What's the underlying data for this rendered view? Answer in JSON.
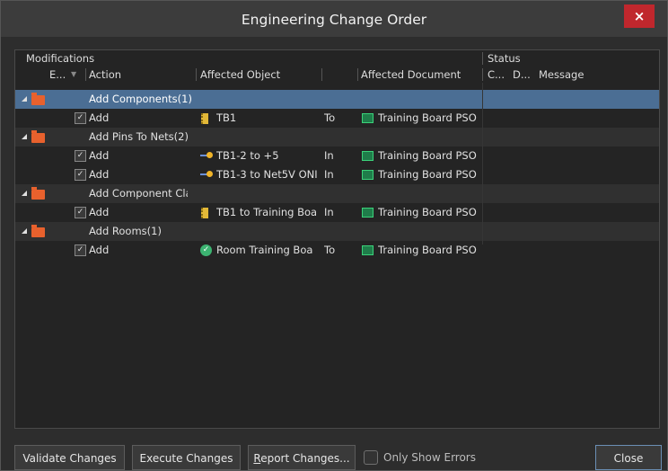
{
  "window": {
    "title": "Engineering Change Order",
    "close_glyph": "×"
  },
  "groups": {
    "modifications": "Modifications",
    "status": "Status"
  },
  "columns": {
    "enable": "E...",
    "action": "Action",
    "affected_object": "Affected Object",
    "affected_document": "Affected Document",
    "check": "C...",
    "done": "D...",
    "message": "Message"
  },
  "rows": [
    {
      "type": "group",
      "label": "Add Components(1)",
      "selected": true
    },
    {
      "type": "item",
      "action": "Add",
      "icon": "component-icon",
      "object": "TB1",
      "dir": "To",
      "document": "Training Board PSO"
    },
    {
      "type": "group",
      "label": "Add Pins To Nets(2)"
    },
    {
      "type": "item",
      "action": "Add",
      "icon": "pin-icon",
      "object": "TB1-2 to +5",
      "dir": "In",
      "document": "Training Board PSO"
    },
    {
      "type": "item",
      "action": "Add",
      "icon": "pin-icon",
      "object": "TB1-3 to Net5V ONI",
      "dir": "In",
      "document": "Training Board PSO"
    },
    {
      "type": "group",
      "label": "Add Component Cla"
    },
    {
      "type": "item",
      "action": "Add",
      "icon": "component-icon",
      "object": "TB1 to Training Boa",
      "dir": "In",
      "document": "Training Board PSO"
    },
    {
      "type": "group",
      "label": "Add Rooms(1)"
    },
    {
      "type": "item",
      "action": "Add",
      "icon": "room-icon",
      "object": "Room Training Boa",
      "dir": "To",
      "document": "Training Board PSO"
    }
  ],
  "buttons": {
    "validate": "Validate Changes",
    "execute": "Execute Changes",
    "report_prefix": "R",
    "report_rest": "eport Changes...",
    "only_errors": "Only Show Errors",
    "close": "Close"
  }
}
